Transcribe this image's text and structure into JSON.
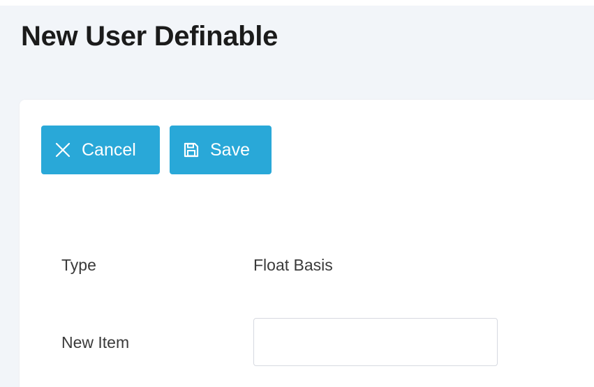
{
  "header": {
    "title": "New User Definable"
  },
  "toolbar": {
    "cancel_label": "Cancel",
    "cancel_icon": "close-icon",
    "save_label": "Save",
    "save_icon": "save-icon",
    "button_color": "#29a8d8"
  },
  "form": {
    "type_label": "Type",
    "type_value": "Float Basis",
    "new_item_label": "New Item",
    "new_item_value": "",
    "new_item_placeholder": ""
  }
}
